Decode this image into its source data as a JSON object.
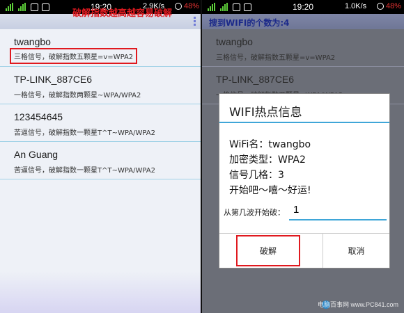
{
  "left": {
    "status": {
      "time": "19:20",
      "speed": "2.9K/s",
      "battery": "48%"
    },
    "annotation": "破解指数越高越容易破解",
    "networks": [
      {
        "ssid": "twangbo",
        "desc": "三格信号，破解指数五颗星=v=WPA2"
      },
      {
        "ssid": "TP-LINK_887CE6",
        "desc": "一格信号，破解指数两颗星~WPA/WPA2"
      },
      {
        "ssid": "123454645",
        "desc": "苦逼信号，破解指数一颗星T^T~WPA/WPA2"
      },
      {
        "ssid": "An Guang",
        "desc": "苦逼信号，破解指数一颗星T^T~WPA/WPA2"
      }
    ]
  },
  "right": {
    "status": {
      "time": "19:20",
      "speed": "1.0K/s",
      "battery": "48%"
    },
    "header": "搜到WIFI的个数为:4",
    "networks": [
      {
        "ssid": "twangbo",
        "desc": "三格信号，破解指数五颗星=v=WPA2"
      },
      {
        "ssid": "TP-LINK_887CE6",
        "desc": "一格信号，破解指数两颗星~WPA/WPA2"
      }
    ],
    "dialog": {
      "title": "WIFI热点信息",
      "wifi_name": "WiFi名：twangbo",
      "encryption": "加密类型：WPA2",
      "signal": "信号几格：3",
      "start": "开始吧～嘻～好运!",
      "field_label": "从第几波开始破：",
      "field_value": "1",
      "ok_label": "破解",
      "cancel_label": "取消"
    },
    "watermark": "电脑百事网 www.PC841.com"
  }
}
